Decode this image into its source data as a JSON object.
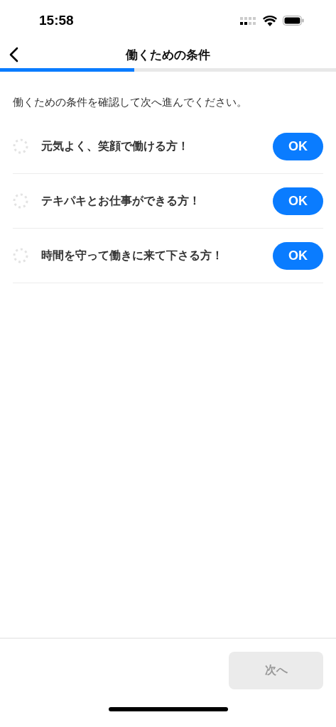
{
  "status_bar": {
    "time": "15:58"
  },
  "header": {
    "title": "働くための条件"
  },
  "progress": {
    "level": 0.4
  },
  "instruction": "働くための条件を確認して次へ進んでください。",
  "conditions": [
    {
      "text": "元気よく、笑顔で働ける方！",
      "checked": false,
      "button": "OK"
    },
    {
      "text": "テキパキとお仕事ができる方！",
      "checked": false,
      "button": "OK"
    },
    {
      "text": "時間を守って働きに来て下さる方！",
      "checked": false,
      "button": "OK"
    }
  ],
  "next_button": {
    "label": "次へ",
    "disabled": true
  }
}
